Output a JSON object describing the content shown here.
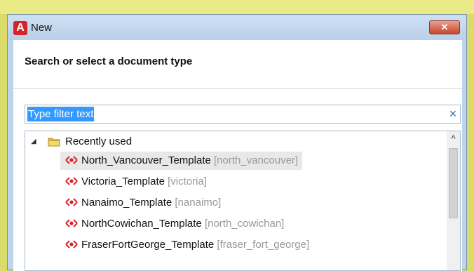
{
  "window": {
    "title": "New",
    "close_label": "✕"
  },
  "header": {
    "text": "Search or select a document type"
  },
  "filter": {
    "value": "Type filter text",
    "clear_label": "×"
  },
  "tree": {
    "group": {
      "label": "Recently used",
      "expanded_glyph": "◢"
    },
    "items": [
      {
        "name": "North_Vancouver_Template",
        "hint": "[north_vancouver]",
        "selected": true
      },
      {
        "name": "Victoria_Template",
        "hint": "[victoria]",
        "selected": false
      },
      {
        "name": "Nanaimo_Template",
        "hint": "[nanaimo]",
        "selected": false
      },
      {
        "name": "NorthCowichan_Template",
        "hint": "[north_cowichan]",
        "selected": false
      },
      {
        "name": "FraserFortGeorge_Template",
        "hint": "[fraser_fort_george]",
        "selected": false
      }
    ]
  },
  "scrollbar": {
    "up_glyph": "^"
  },
  "colors": {
    "selection": "#3399ff",
    "template_icon": "#d6232a",
    "close_button": "#c8462d"
  },
  "icons": {
    "app": "acrobat-style-icon",
    "folder": "folder-icon",
    "template": "template-icon"
  }
}
